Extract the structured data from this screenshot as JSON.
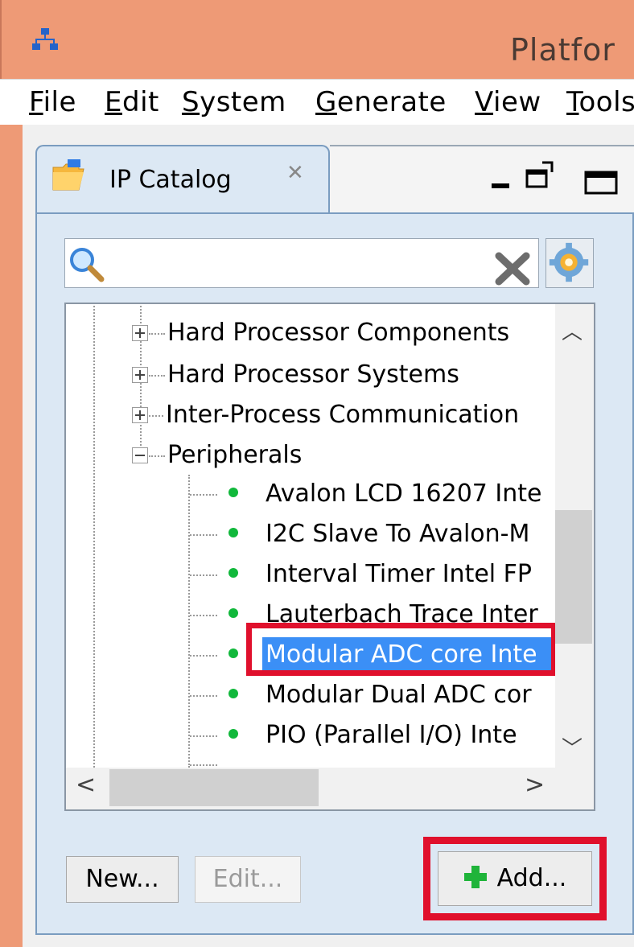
{
  "window": {
    "title": "Platfor"
  },
  "menubar": {
    "items": [
      {
        "first": "F",
        "rest": "ile"
      },
      {
        "first": "E",
        "rest": "dit"
      },
      {
        "first": "S",
        "rest": "ystem"
      },
      {
        "first": "G",
        "rest": "enerate"
      },
      {
        "first": "V",
        "rest": "iew"
      },
      {
        "first": "T",
        "rest": "ools"
      }
    ]
  },
  "ip_catalog": {
    "tab_label": "IP Catalog",
    "search": {
      "value": "",
      "placeholder": ""
    },
    "tree": {
      "categories": [
        {
          "label": "Hard Processor Components",
          "expanded": false
        },
        {
          "label": "Hard Processor Systems",
          "expanded": false
        },
        {
          "label": "Inter-Process Communication",
          "expanded": false
        },
        {
          "label": "Peripherals",
          "expanded": true
        }
      ],
      "peripherals": [
        "Avalon LCD 16207 Inte",
        "I2C Slave To Avalon-M",
        "Interval Timer Intel FP",
        "Lauterbach Trace Inter",
        "Modular ADC core Inte",
        "Modular Dual ADC cor",
        "PIO (Parallel I/O) Inte"
      ],
      "selected": "Modular ADC core Inte"
    },
    "buttons": {
      "new": "New...",
      "edit": "Edit...",
      "add": "Add..."
    }
  },
  "colors": {
    "title_bar": "#ee9a76",
    "selection": "#3b8ff6",
    "highlight_box": "#e0102c",
    "status_dot": "#11b83b",
    "add_icon": "#1fb43a"
  }
}
